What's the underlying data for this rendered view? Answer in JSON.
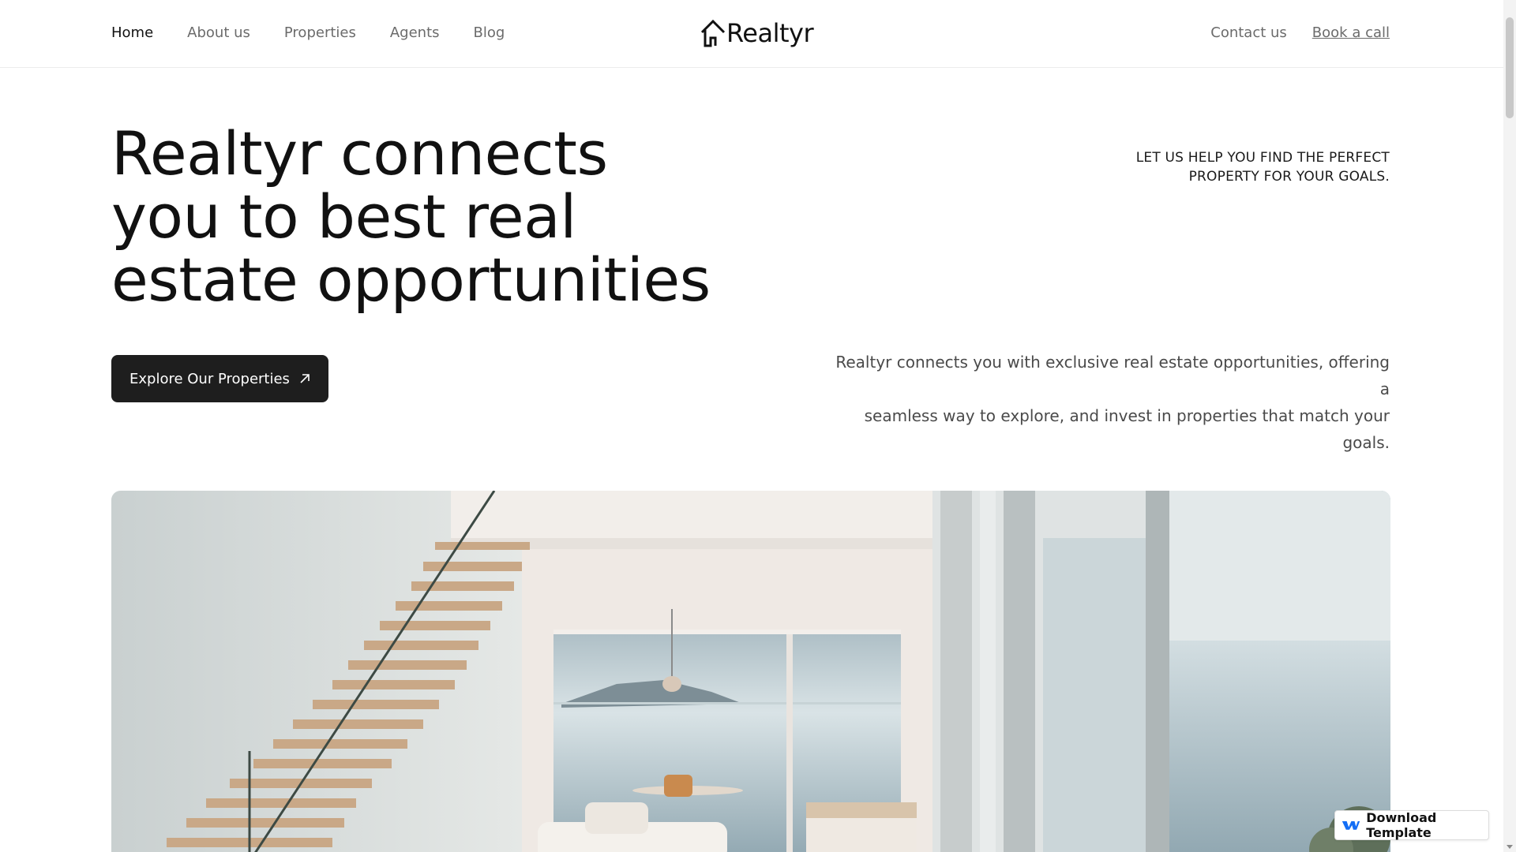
{
  "nav": {
    "links": [
      {
        "label": "Home",
        "active": true
      },
      {
        "label": "About us",
        "active": false
      },
      {
        "label": "Properties",
        "active": false
      },
      {
        "label": "Agents",
        "active": false
      },
      {
        "label": "Blog",
        "active": false
      }
    ],
    "brand": "Realtyr",
    "brand_icon": "house-icon",
    "contact_label": "Contact us",
    "book_label": "Book a call"
  },
  "hero": {
    "title_lines": [
      "Realtyr connects",
      "you to best real",
      "estate opportunities"
    ],
    "kicker_lines": [
      "LET US HELP YOU FIND THE PERFECT",
      "PROPERTY FOR YOUR GOALS."
    ],
    "cta_label": "Explore Our Properties",
    "cta_icon": "arrow-up-right-icon",
    "description_lines": [
      "Realtyr connects you with exclusive real estate opportunities, offering a",
      "seamless way to explore, and invest in properties that match your goals."
    ],
    "image_alt": "bright-interior-with-staircase-and-sea-view"
  },
  "badge": {
    "label": "Download Template",
    "icon": "webflow-logo-icon",
    "accent": "#146ef5"
  },
  "colors": {
    "text": "#111111",
    "muted": "#6b6b6b",
    "button_bg": "#1e1e1e",
    "loader_accent": "#3b82c4"
  }
}
